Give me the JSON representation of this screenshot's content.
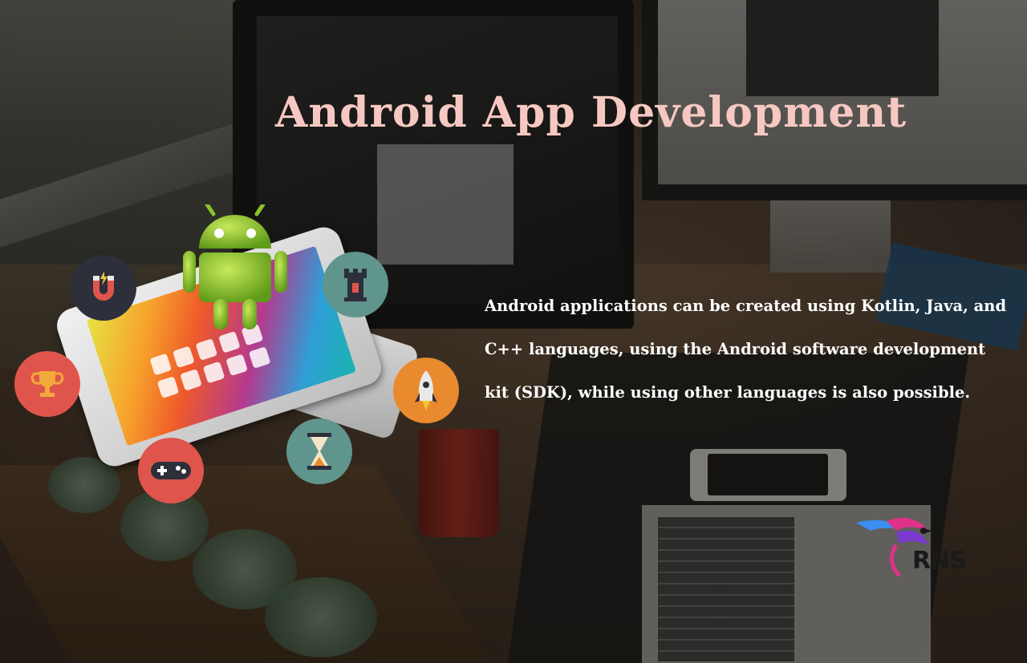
{
  "title": "Android App Development",
  "paragraph": "Android applications can be created using Kotlin, Java, and C++ languages, using the Android software development kit (SDK), while using other languages  is also possible.",
  "logo": {
    "text": "RNS",
    "colors": {
      "wing_blue": "#3b8ff0",
      "wing_pink": "#e0318a",
      "wing_purple": "#7a3ad0",
      "text": "#1a1a1a"
    }
  },
  "icons": [
    {
      "name": "magnet-icon",
      "color": "#2d2f3b"
    },
    {
      "name": "trophy-icon",
      "color": "#e0554b"
    },
    {
      "name": "gamepad-icon",
      "color": "#e0554b"
    },
    {
      "name": "hourglass-icon",
      "color": "#5f958d"
    },
    {
      "name": "rocket-icon",
      "color": "#e98a2f"
    },
    {
      "name": "castle-tower-icon",
      "color": "#5f958d"
    },
    {
      "name": "android-robot-icon",
      "color": "#8bc22e"
    }
  ],
  "colors": {
    "title": "#f6c8c1",
    "paragraph": "#ffffff"
  }
}
